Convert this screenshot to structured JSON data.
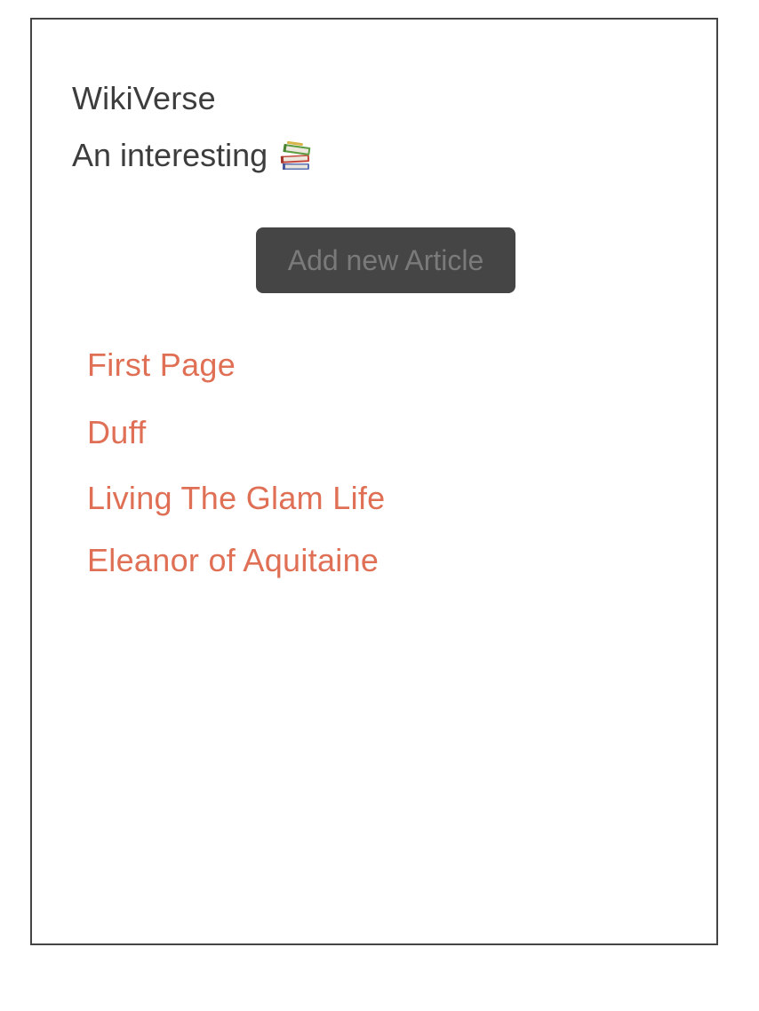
{
  "header": {
    "title": "WikiVerse",
    "tagline": "An interesting"
  },
  "icons": {
    "tagline_icon": "books-icon"
  },
  "actions": {
    "add_article_label": "Add new Article"
  },
  "articles": [
    {
      "title": "First Page"
    },
    {
      "title": "Duff"
    },
    {
      "title": "Living The Glam Life"
    },
    {
      "title": "Eleanor of Aquitaine"
    }
  ],
  "colors": {
    "link": "#e07055",
    "button_bg": "#454545",
    "button_text": "#7a7a7a",
    "text": "#3d3d3d",
    "border": "#444444"
  }
}
